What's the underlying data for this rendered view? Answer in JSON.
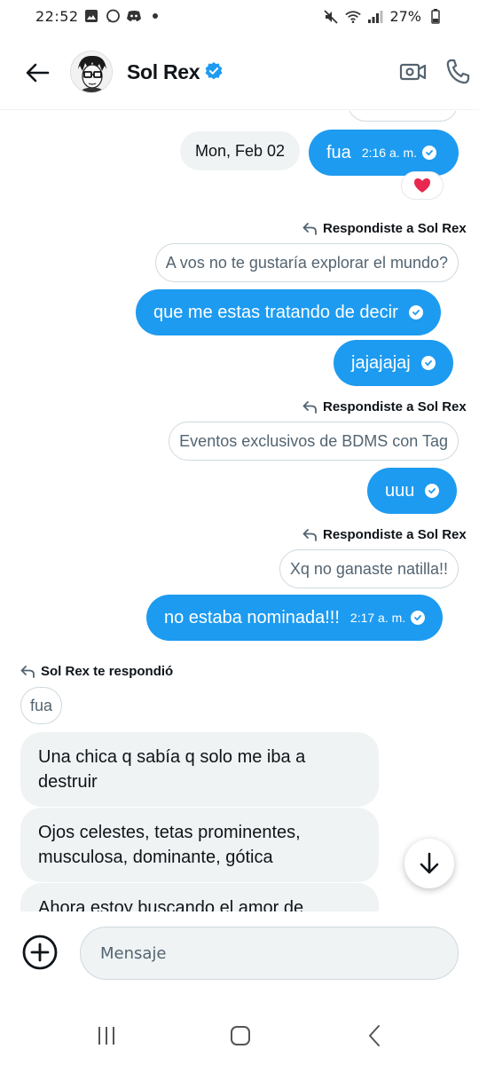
{
  "status_bar": {
    "time": "22:52",
    "battery": "27%"
  },
  "header": {
    "contact_name": "Sol Rex",
    "back_icon": "arrow-left-icon",
    "verified_icon": "verified-badge-icon",
    "video_icon": "video-call-icon",
    "phone_icon": "phone-icon",
    "accent_color": "#1d9bf0"
  },
  "chat": {
    "date_chip": "Mon, Feb 02",
    "msg_fua": {
      "text": "fua",
      "time": "2:16 a. m."
    },
    "reaction_emoji": "❤️",
    "reply_label_out": "Respondiste a Sol Rex",
    "quote_1": "A vos no te gustaría explorar el mundo?",
    "msg_que": {
      "text": "que me estas tratando de decir"
    },
    "msg_jaja": {
      "text": "jajajajaj"
    },
    "quote_2": "Eventos exclusivos de BDMS con Tag",
    "msg_uuu": {
      "text": "uuu"
    },
    "quote_3": "Xq no ganaste natilla!!",
    "msg_no": {
      "text": "no estaba nominada!!!",
      "time": "2:17 a. m."
    },
    "reply_label_in": "Sol Rex te respondió",
    "quote_in": "fua",
    "incoming": [
      "Una chica q sabía q solo me iba a destruir",
      "Ojos celestes, tetas prominentes, musculosa, dominante, gótica",
      "Ahora estoy buscando el amor de"
    ]
  },
  "composer": {
    "placeholder": "Mensaje"
  }
}
